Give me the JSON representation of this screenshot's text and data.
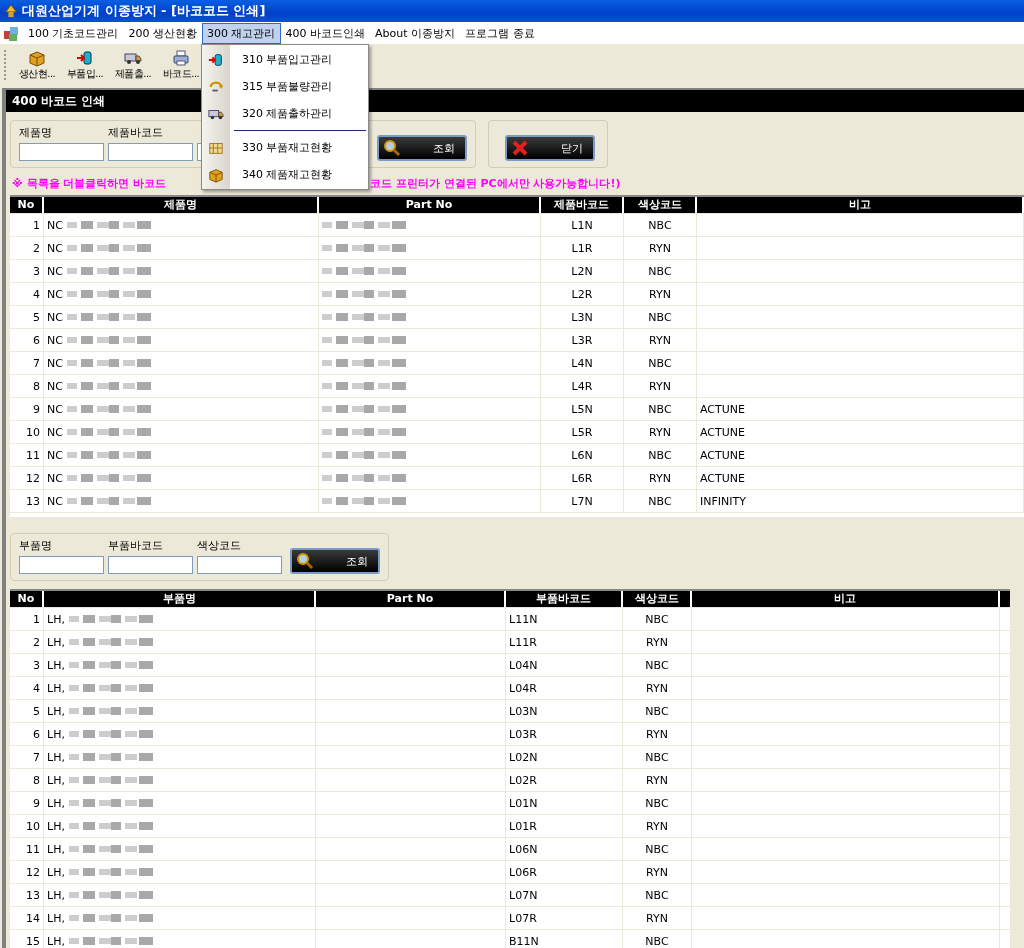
{
  "window": {
    "title": "대원산업기계 이종방지 - [바코코드 인쇄]"
  },
  "menu": [
    {
      "label": "100 기초코드관리",
      "selected": false
    },
    {
      "label": "200 생산현황",
      "selected": false
    },
    {
      "label": "300 재고관리",
      "selected": true
    },
    {
      "label": "400 바코드인쇄",
      "selected": false
    },
    {
      "label": "About 이종방지",
      "selected": false
    },
    {
      "label": "프로그램 종료",
      "selected": false
    }
  ],
  "toolbar": [
    {
      "label": "생산현..."
    },
    {
      "label": "부품입..."
    },
    {
      "label": "제품출..."
    },
    {
      "label": "바코드..."
    }
  ],
  "dropdown": [
    {
      "kind": "item",
      "label": "310 부품입고관리"
    },
    {
      "kind": "item",
      "label": "315 부품불량관리"
    },
    {
      "kind": "item",
      "label": "320 제품출하관리"
    },
    {
      "kind": "separator"
    },
    {
      "kind": "item",
      "label": "330 부품재고현황"
    },
    {
      "kind": "item",
      "label": "340 제품재고현황"
    }
  ],
  "child_window": {
    "title": "400 바코드 인쇄"
  },
  "product_search": {
    "fields": [
      {
        "label": "제품명"
      },
      {
        "label": "제품바코드"
      }
    ],
    "search_button": "조회",
    "close_button": "닫기"
  },
  "notice": [
    "※ 목록을 더블클릭하면 바코드",
    "코드 프린터가 연결된 PC에서만 사용가능합니다!)"
  ],
  "product_table": {
    "columns": [
      {
        "label": "No"
      },
      {
        "label": "제품명"
      },
      {
        "label": "Part No"
      },
      {
        "label": "제품바코드"
      },
      {
        "label": "색상코드"
      },
      {
        "label": "비고"
      }
    ],
    "rows": [
      [
        "1",
        "NC",
        "",
        "L1N",
        "NBC",
        ""
      ],
      [
        "2",
        "NC",
        "",
        "L1R",
        "RYN",
        ""
      ],
      [
        "3",
        "NC",
        "",
        "L2N",
        "NBC",
        ""
      ],
      [
        "4",
        "NC",
        "",
        "L2R",
        "RYN",
        ""
      ],
      [
        "5",
        "NC",
        "",
        "L3N",
        "NBC",
        ""
      ],
      [
        "6",
        "NC",
        "",
        "L3R",
        "RYN",
        ""
      ],
      [
        "7",
        "NC",
        "",
        "L4N",
        "NBC",
        ""
      ],
      [
        "8",
        "NC",
        "",
        "L4R",
        "RYN",
        ""
      ],
      [
        "9",
        "NC",
        "",
        "L5N",
        "NBC",
        "ACTUNE"
      ],
      [
        "10",
        "NC",
        "",
        "L5R",
        "RYN",
        "ACTUNE"
      ],
      [
        "11",
        "NC",
        "",
        "L6N",
        "NBC",
        "ACTUNE"
      ],
      [
        "12",
        "NC",
        "",
        "L6R",
        "RYN",
        "ACTUNE"
      ],
      [
        "13",
        "NC",
        "",
        "L7N",
        "NBC",
        "INFINITY"
      ]
    ]
  },
  "part_search": {
    "fields": [
      {
        "label": "부품명"
      },
      {
        "label": "부품바코드"
      },
      {
        "label": "색상코드"
      }
    ],
    "search_button": "조회"
  },
  "part_table": {
    "columns": [
      {
        "label": "No"
      },
      {
        "label": "부품명"
      },
      {
        "label": "Part No"
      },
      {
        "label": "부품바코드"
      },
      {
        "label": "색상코드"
      },
      {
        "label": "비고"
      }
    ],
    "rows": [
      [
        "1",
        "LH,",
        "",
        "L11N",
        "NBC",
        ""
      ],
      [
        "2",
        "LH,",
        "",
        "L11R",
        "RYN",
        ""
      ],
      [
        "3",
        "LH,",
        "",
        "L04N",
        "NBC",
        ""
      ],
      [
        "4",
        "LH,",
        "",
        "L04R",
        "RYN",
        ""
      ],
      [
        "5",
        "LH,",
        "",
        "L03N",
        "NBC",
        ""
      ],
      [
        "6",
        "LH,",
        "",
        "L03R",
        "RYN",
        ""
      ],
      [
        "7",
        "LH,",
        "",
        "L02N",
        "NBC",
        ""
      ],
      [
        "8",
        "LH,",
        "",
        "L02R",
        "RYN",
        ""
      ],
      [
        "9",
        "LH,",
        "",
        "L01N",
        "NBC",
        ""
      ],
      [
        "10",
        "LH,",
        "",
        "L01R",
        "RYN",
        ""
      ],
      [
        "11",
        "LH,",
        "",
        "L06N",
        "NBC",
        ""
      ],
      [
        "12",
        "LH,",
        "",
        "L06R",
        "RYN",
        ""
      ],
      [
        "13",
        "LH,",
        "",
        "L07N",
        "NBC",
        ""
      ],
      [
        "14",
        "LH,",
        "",
        "L07R",
        "RYN",
        ""
      ],
      [
        "15",
        "LH,",
        "",
        "B11N",
        "NBC",
        ""
      ]
    ]
  }
}
